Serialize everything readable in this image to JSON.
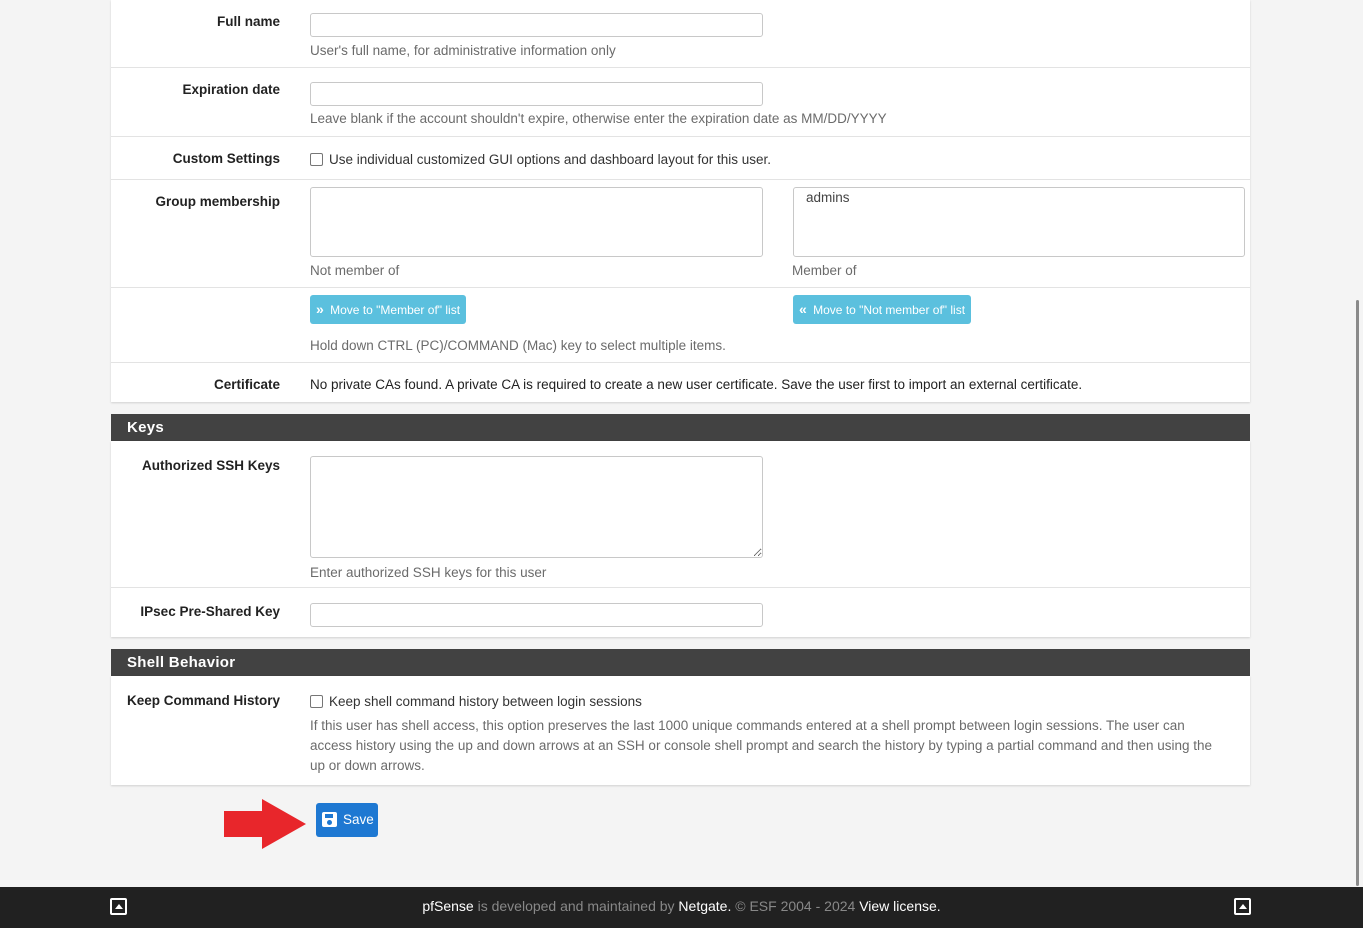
{
  "user_form": {
    "full_name": {
      "label": "Full name",
      "value": "",
      "help": "User's full name, for administrative information only"
    },
    "expiration_date": {
      "label": "Expiration date",
      "value": "",
      "help": "Leave blank if the account shouldn't expire, otherwise enter the expiration date as MM/DD/YYYY"
    },
    "custom_settings": {
      "label": "Custom Settings",
      "checked": false,
      "text": "Use individual customized GUI options and dashboard layout for this user."
    },
    "group_membership": {
      "label": "Group membership",
      "not_member_of": [],
      "member_of": [
        "admins"
      ],
      "not_member_label": "Not member of",
      "member_label": "Member of",
      "move_to_member_button": "Move to \"Member of\" list",
      "move_to_not_member_button": "Move to \"Not member of\" list",
      "help": "Hold down CTRL (PC)/COMMAND (Mac) key to select multiple items."
    },
    "certificate": {
      "label": "Certificate",
      "text": "No private CAs found. A private CA is required to create a new user certificate. Save the user first to import an external certificate."
    }
  },
  "keys_section": {
    "title": "Keys",
    "ssh_keys": {
      "label": "Authorized SSH Keys",
      "value": "",
      "help": "Enter authorized SSH keys for this user"
    },
    "ipsec_psk": {
      "label": "IPsec Pre-Shared Key",
      "value": ""
    }
  },
  "shell_section": {
    "title": "Shell Behavior",
    "keep_history": {
      "label": "Keep Command History",
      "checked": false,
      "text": "Keep shell command history between login sessions",
      "help": "If this user has shell access, this option preserves the last 1000 unique commands entered at a shell prompt between login sessions. The user can access history using the up and down arrows at an SSH or console shell prompt and search the history by typing a partial command and then using the up or down arrows."
    }
  },
  "save_button": "Save",
  "annotation": {
    "type": "red-arrow",
    "points_to": "save-button",
    "color": "#e8262b"
  },
  "footer": {
    "brand": "pfSense",
    "text1": " is developed and maintained by ",
    "company": "Netgate.",
    "text2": " © ESF 2004 - 2024 ",
    "license_link": "View license."
  },
  "colors": {
    "info_button": "#5bc0de",
    "primary_button": "#1e78d2",
    "section_header": "#424242",
    "footer_bg": "#212121"
  }
}
